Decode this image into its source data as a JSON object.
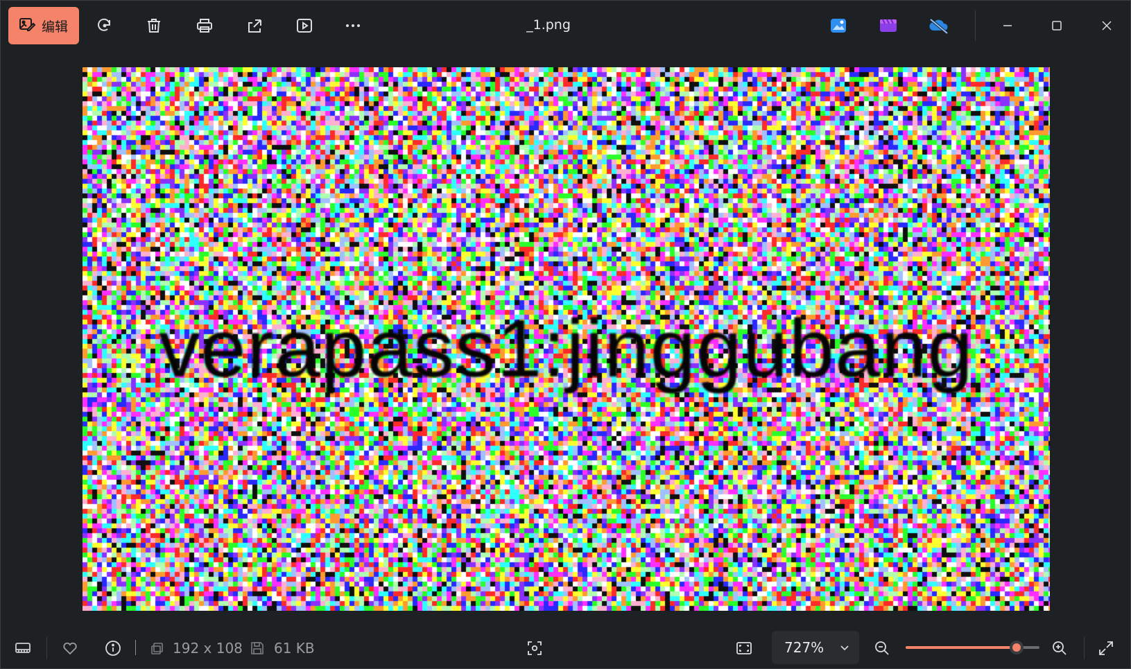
{
  "window": {
    "title": "_1.png"
  },
  "toolbar": {
    "edit_label": "编辑",
    "buttons": [
      "rotate-icon",
      "delete-icon",
      "print-icon",
      "share-icon",
      "slideshow-icon",
      "more-icon"
    ],
    "accent_color": "#f4836a"
  },
  "right_apps": [
    "photo-editor-icon",
    "clipchamp-icon",
    "onedrive-icon"
  ],
  "image": {
    "embedded_text": "verapass1:jinggubang"
  },
  "status": {
    "dimensions": "192 x 108",
    "file_size": "61 KB"
  },
  "zoom": {
    "value_label": "727%",
    "slider_fraction": 0.83
  }
}
